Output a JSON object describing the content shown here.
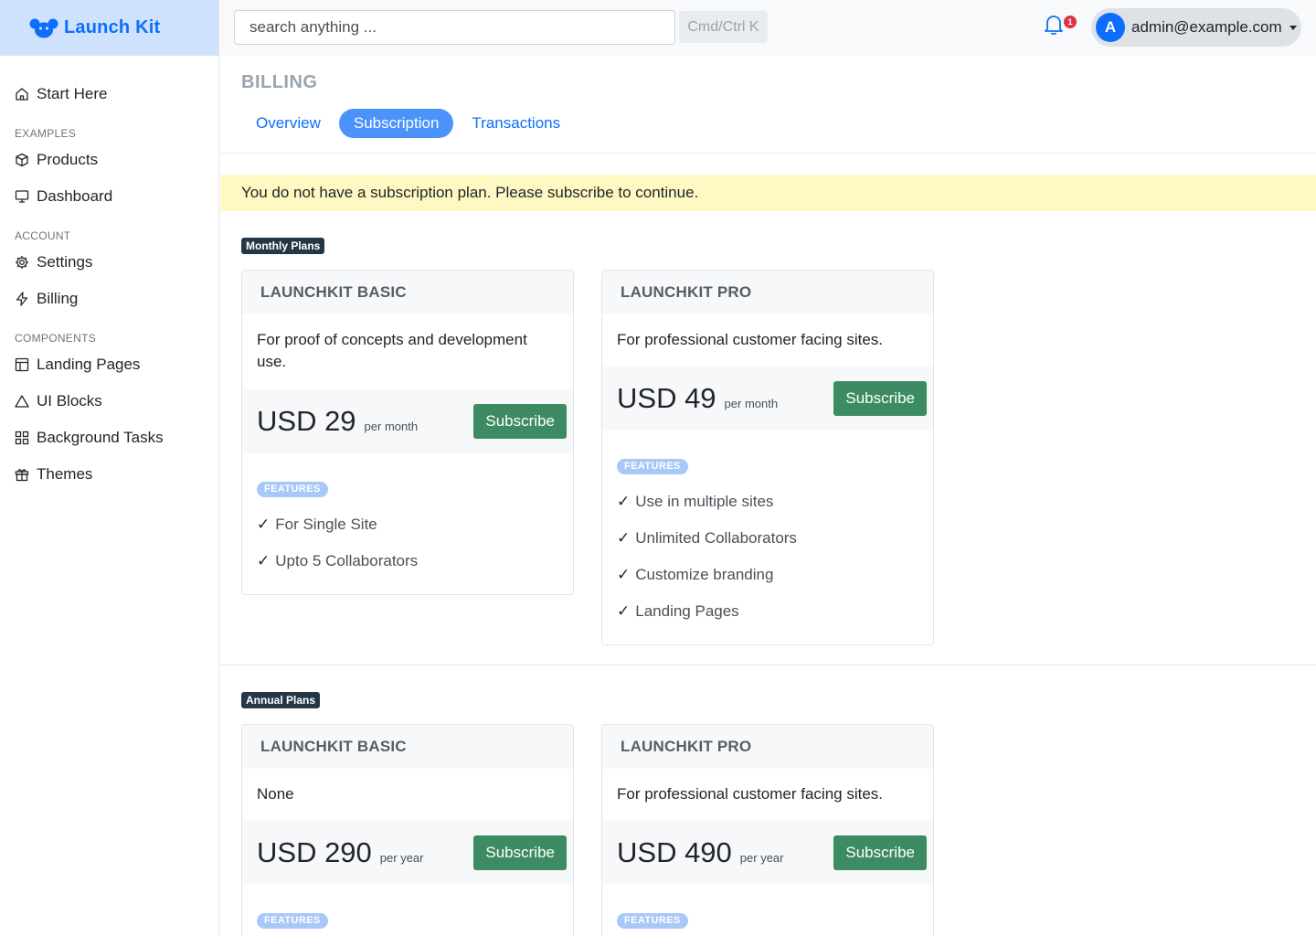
{
  "brand": {
    "name": "Launch Kit"
  },
  "sidebar": {
    "items": [
      {
        "label": "Start Here",
        "icon": "home-icon"
      }
    ],
    "sections": [
      {
        "title": "EXAMPLES",
        "items": [
          {
            "label": "Products",
            "icon": "box-icon"
          },
          {
            "label": "Dashboard",
            "icon": "monitor-icon"
          }
        ]
      },
      {
        "title": "ACCOUNT",
        "items": [
          {
            "label": "Settings",
            "icon": "gear-icon"
          },
          {
            "label": "Billing",
            "icon": "zap-icon"
          }
        ]
      },
      {
        "title": "COMPONENTS",
        "items": [
          {
            "label": "Landing Pages",
            "icon": "layout-icon"
          },
          {
            "label": "UI Blocks",
            "icon": "triangle-icon"
          },
          {
            "label": "Background Tasks",
            "icon": "grid-icon"
          },
          {
            "label": "Themes",
            "icon": "gift-icon"
          }
        ]
      }
    ]
  },
  "topbar": {
    "search_placeholder": "search anything ...",
    "shortcut_hint": "Cmd/Ctrl K",
    "notification_count": "1",
    "user_initial": "A",
    "user_email": "admin@example.com"
  },
  "page": {
    "title": "BILLING",
    "tabs": [
      {
        "label": "Overview",
        "active": false
      },
      {
        "label": "Subscription",
        "active": true
      },
      {
        "label": "Transactions",
        "active": false
      }
    ],
    "alert": "You do not have a subscription plan. Please subscribe to continue."
  },
  "plans": {
    "monthly": {
      "title": "Monthly Plans",
      "cards": [
        {
          "name": "LAUNCHKIT BASIC",
          "description": "For proof of concepts and development use.",
          "price": "USD 29",
          "period": "per month",
          "button": "Subscribe",
          "features_label": "FEATURES",
          "features": [
            "For Single Site",
            "Upto 5 Collaborators"
          ]
        },
        {
          "name": "LAUNCHKIT PRO",
          "description": "For professional customer facing sites.",
          "price": "USD 49",
          "period": "per month",
          "button": "Subscribe",
          "features_label": "FEATURES",
          "features": [
            "Use in multiple sites",
            "Unlimited Collaborators",
            "Customize branding",
            "Landing Pages"
          ]
        }
      ]
    },
    "annual": {
      "title": "Annual Plans",
      "cards": [
        {
          "name": "LAUNCHKIT BASIC",
          "description": "None",
          "price": "USD 290",
          "period": "per year",
          "button": "Subscribe",
          "features_label": "FEATURES"
        },
        {
          "name": "LAUNCHKIT PRO",
          "description": "For professional customer facing sites.",
          "price": "USD 490",
          "period": "per year",
          "button": "Subscribe",
          "features_label": "FEATURES"
        }
      ]
    }
  },
  "check_mark": "✓",
  "colors": {
    "brand": "#0d6efd",
    "subscribe": "#3d8b63",
    "alert_bg": "#fef9c3",
    "active_tab": "#4b92fb"
  }
}
